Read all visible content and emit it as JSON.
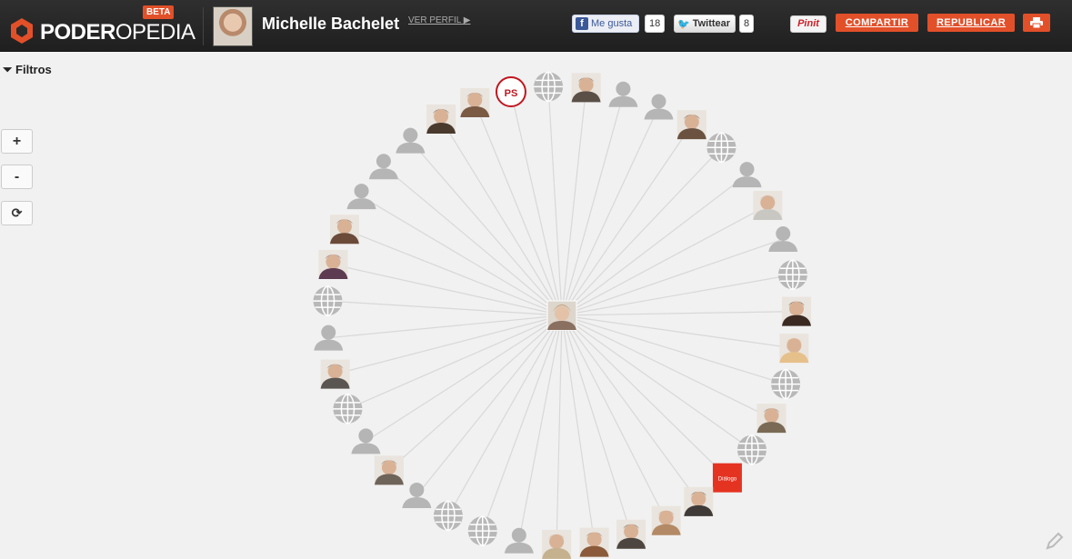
{
  "header": {
    "logo_bold": "PODER",
    "logo_light": "OPEDIA",
    "beta_label": "BETA",
    "profile_name": "Michelle Bachelet",
    "ver_perfil": "VER PERFIL ▶",
    "facebook_label": "Me gusta",
    "facebook_count": "18",
    "twitter_label": "Twittear",
    "twitter_count": "8",
    "pinterest_label": "Pinit",
    "compartir_label": "COMPARTIR",
    "republicar_label": "REPUBLICAR",
    "print_icon": "print-icon"
  },
  "sidebar": {
    "filters_label": "Filtros",
    "zoom_in": "+",
    "zoom_out": "-",
    "reset_icon": "refresh-icon"
  },
  "graph": {
    "center": {
      "type": "photo",
      "name": "Michelle Bachelet"
    },
    "nodes": [
      {
        "type": "photo",
        "tone": "#7b5a44"
      },
      {
        "type": "logo",
        "label": "PS",
        "color": "#c0171f"
      },
      {
        "type": "globe"
      },
      {
        "type": "photo",
        "tone": "#5a5048"
      },
      {
        "type": "person"
      },
      {
        "type": "person"
      },
      {
        "type": "photo",
        "tone": "#6a5140"
      },
      {
        "type": "globe"
      },
      {
        "type": "person"
      },
      {
        "type": "photo",
        "tone": "#c9c7c2"
      },
      {
        "type": "person"
      },
      {
        "type": "globe"
      },
      {
        "type": "photo",
        "tone": "#3a2a22"
      },
      {
        "type": "photo",
        "tone": "#e6c08b"
      },
      {
        "type": "globe"
      },
      {
        "type": "photo",
        "tone": "#7a6a55"
      },
      {
        "type": "globe"
      },
      {
        "type": "logo",
        "label": "Diálogo",
        "color": "#e53322"
      },
      {
        "type": "photo",
        "tone": "#3f3a38"
      },
      {
        "type": "photo",
        "tone": "#b38a65"
      },
      {
        "type": "photo",
        "tone": "#4d4540"
      },
      {
        "type": "photo",
        "tone": "#8a5a3a"
      },
      {
        "type": "photo",
        "tone": "#c6b18f"
      },
      {
        "type": "person"
      },
      {
        "type": "globe"
      },
      {
        "type": "globe"
      },
      {
        "type": "person"
      },
      {
        "type": "photo",
        "tone": "#6f6459"
      },
      {
        "type": "person"
      },
      {
        "type": "globe"
      },
      {
        "type": "photo",
        "tone": "#5b5552"
      },
      {
        "type": "person"
      },
      {
        "type": "globe"
      },
      {
        "type": "photo",
        "tone": "#5d3c52"
      },
      {
        "type": "photo",
        "tone": "#6b4a3a"
      },
      {
        "type": "person"
      },
      {
        "type": "person"
      },
      {
        "type": "person"
      },
      {
        "type": "photo",
        "tone": "#4a3a2e"
      }
    ]
  }
}
